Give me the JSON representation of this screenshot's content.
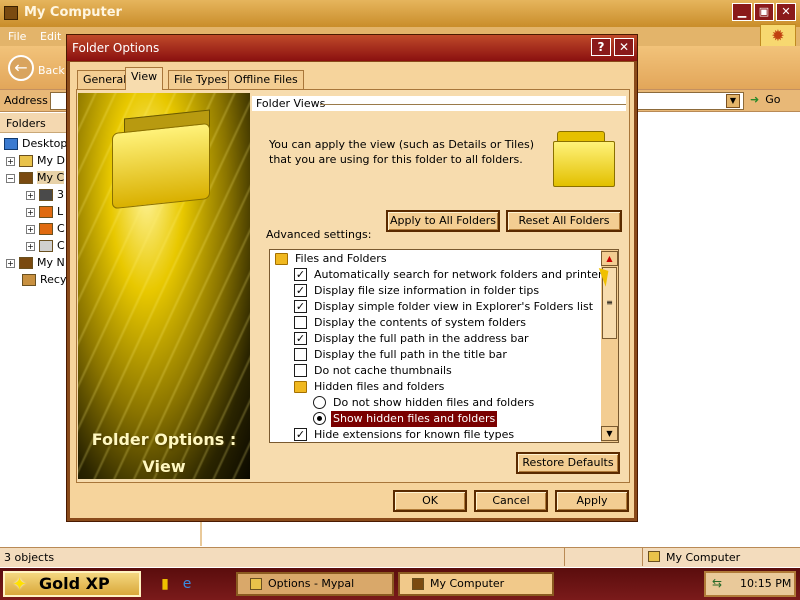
{
  "window": {
    "title": "My Computer",
    "menu": [
      "File",
      "Edit"
    ],
    "back_label": "Back",
    "address_label": "Address",
    "go_label": "Go",
    "folders_header": "Folders",
    "tree": [
      {
        "label": "Desktop"
      },
      {
        "label": "My D"
      },
      {
        "label": "My C"
      },
      {
        "label": "3"
      },
      {
        "label": "L"
      },
      {
        "label": "C"
      },
      {
        "label": "C"
      },
      {
        "label": "My N"
      },
      {
        "label": "Recy"
      }
    ],
    "status_left": "3 objects",
    "status_right": "My Computer"
  },
  "dialog": {
    "title": "Folder Options",
    "help_glyph": "?",
    "close_glyph": "✕",
    "tabs": [
      "General",
      "View",
      "File Types",
      "Offline Files"
    ],
    "active_tab": "View",
    "side_caption_line1": "Folder Options :",
    "side_caption_line2": "View",
    "section_title": "Folder Views",
    "description": "You can apply the view (such as Details or Tiles) that you are using for this folder to all folders.",
    "apply_all_label": "Apply to All Folders",
    "reset_all_label": "Reset All Folders",
    "advanced_label": "Advanced settings:",
    "settings": [
      {
        "type": "folder",
        "label": "Files and Folders"
      },
      {
        "type": "checkbox",
        "checked": true,
        "label": "Automatically search for network folders and printers"
      },
      {
        "type": "checkbox",
        "checked": true,
        "label": "Display file size information in folder tips"
      },
      {
        "type": "checkbox",
        "checked": true,
        "label": "Display simple folder view in Explorer's Folders list"
      },
      {
        "type": "checkbox",
        "checked": false,
        "label": "Display the contents of system folders"
      },
      {
        "type": "checkbox",
        "checked": true,
        "label": "Display the full path in the address bar"
      },
      {
        "type": "checkbox",
        "checked": false,
        "label": "Display the full path in the title bar"
      },
      {
        "type": "checkbox",
        "checked": false,
        "label": "Do not cache thumbnails"
      },
      {
        "type": "folder",
        "label": "Hidden files and folders"
      },
      {
        "type": "radio",
        "checked": false,
        "label": "Do not show hidden files and folders"
      },
      {
        "type": "radio",
        "checked": true,
        "label": "Show hidden files and folders",
        "selected": true
      },
      {
        "type": "checkbox",
        "checked": true,
        "label": "Hide extensions for known file types"
      }
    ],
    "check_glyph": "✓",
    "restore_label": "Restore Defaults",
    "ok_label": "OK",
    "cancel_label": "Cancel",
    "apply_label": "Apply"
  },
  "taskbar": {
    "start_label": "Gold XP",
    "tasks": [
      {
        "label": "Options - Mypal",
        "active": false
      },
      {
        "label": "My Computer",
        "active": true
      }
    ],
    "clock": "10:15 PM"
  },
  "colors": {
    "title_bar": "#8a1010",
    "dialog_bg": "#f6d49c",
    "accent": "#7a0000",
    "taskbar": "#5a0d0d"
  },
  "icons": {
    "back": "back-arrow-icon",
    "go": "go-arrow-icon",
    "logo": "sun-logo-icon",
    "folder": "folder-icon",
    "start": "star-icon",
    "tray": "network-icon"
  }
}
